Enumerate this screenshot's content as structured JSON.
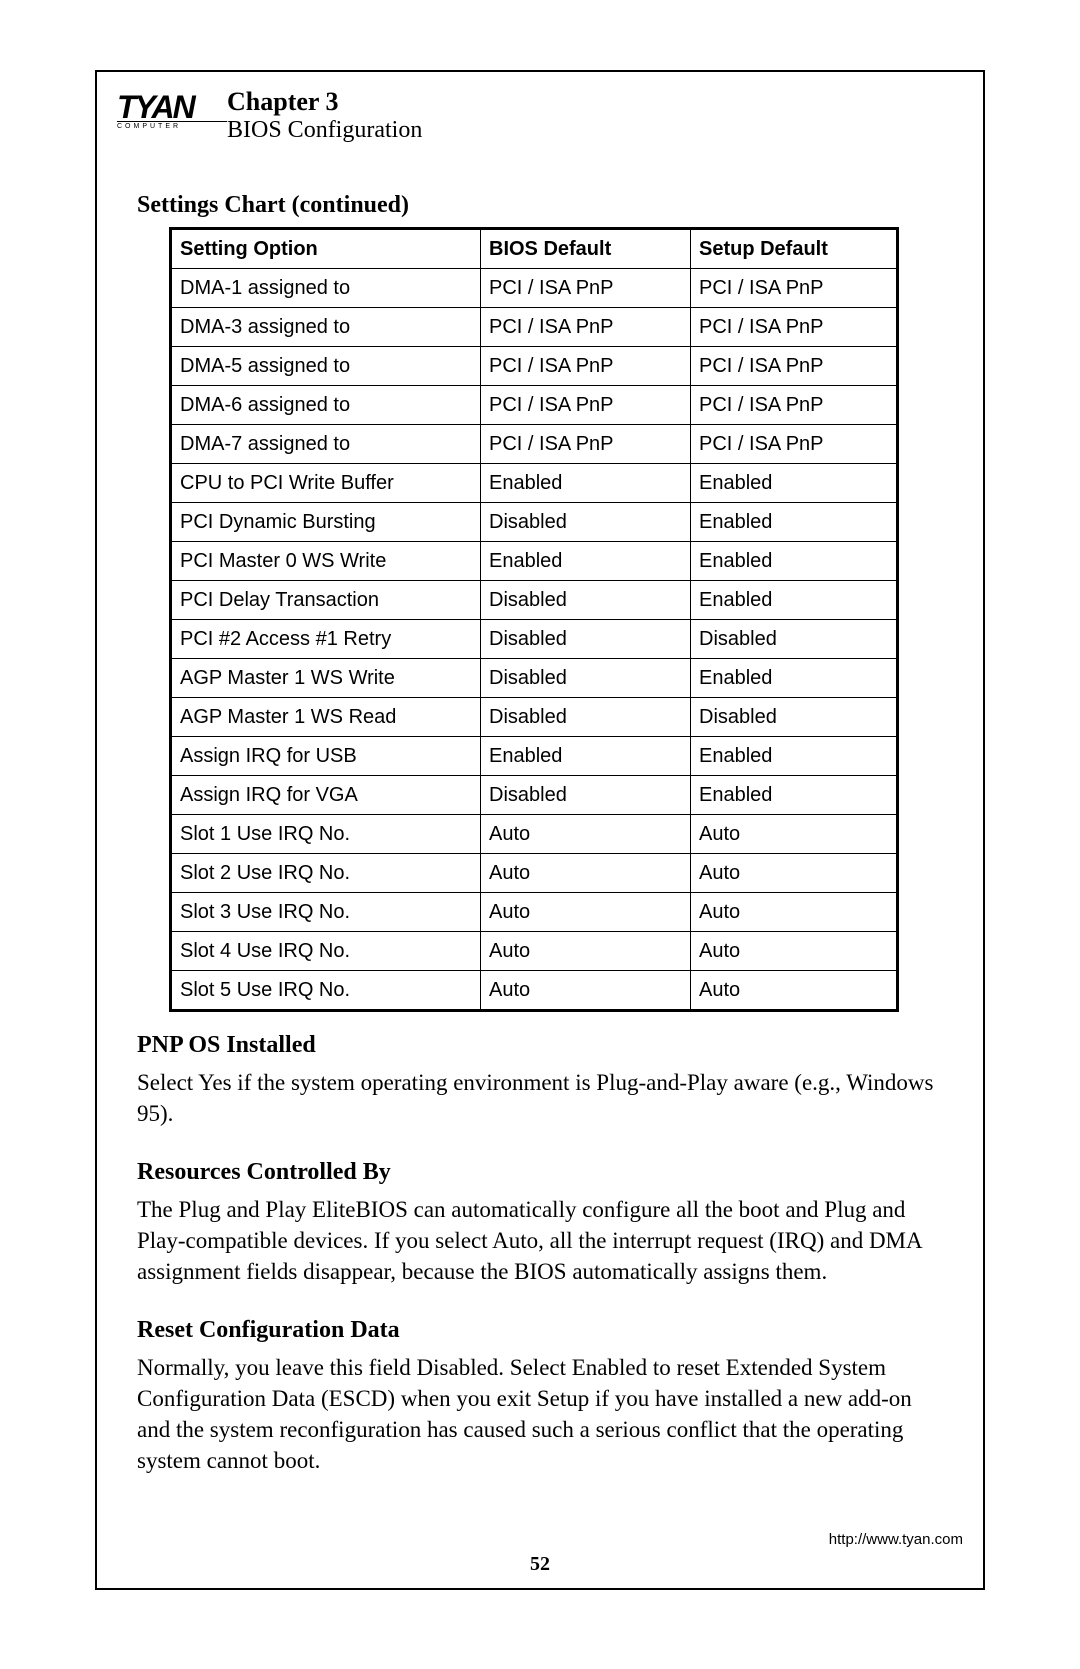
{
  "logo": {
    "brand": "TYAN",
    "sub": "COMPUTER"
  },
  "header": {
    "chapter": "Chapter 3",
    "subtitle": "BIOS Configuration"
  },
  "table": {
    "heading": "Settings Chart (continued)",
    "columns": [
      "Setting Option",
      "BIOS Default",
      "Setup Default"
    ],
    "rows": [
      [
        "DMA-1 assigned to",
        "PCI / ISA PnP",
        "PCI / ISA PnP"
      ],
      [
        "DMA-3 assigned to",
        "PCI / ISA PnP",
        "PCI / ISA PnP"
      ],
      [
        "DMA-5 assigned to",
        "PCI / ISA PnP",
        "PCI / ISA PnP"
      ],
      [
        "DMA-6 assigned to",
        "PCI / ISA PnP",
        "PCI / ISA PnP"
      ],
      [
        "DMA-7 assigned to",
        "PCI / ISA PnP",
        "PCI / ISA PnP"
      ],
      [
        "CPU to PCI Write Buffer",
        "Enabled",
        "Enabled"
      ],
      [
        "PCI Dynamic Bursting",
        "Disabled",
        "Enabled"
      ],
      [
        "PCI Master 0 WS Write",
        "Enabled",
        "Enabled"
      ],
      [
        "PCI Delay Transaction",
        "Disabled",
        "Enabled"
      ],
      [
        "PCI #2 Access #1 Retry",
        "Disabled",
        "Disabled"
      ],
      [
        "AGP Master 1 WS Write",
        "Disabled",
        "Enabled"
      ],
      [
        "AGP Master 1 WS Read",
        "Disabled",
        "Disabled"
      ],
      [
        "Assign IRQ for USB",
        "Enabled",
        "Enabled"
      ],
      [
        "Assign IRQ for VGA",
        "Disabled",
        "Enabled"
      ],
      [
        "Slot 1 Use IRQ No.",
        "Auto",
        "Auto"
      ],
      [
        "Slot 2 Use IRQ No.",
        "Auto",
        "Auto"
      ],
      [
        "Slot 3 Use IRQ No.",
        "Auto",
        "Auto"
      ],
      [
        "Slot 4 Use IRQ No.",
        "Auto",
        "Auto"
      ],
      [
        "Slot 5 Use IRQ No.",
        "Auto",
        "Auto"
      ]
    ]
  },
  "sections": [
    {
      "heading": "PNP OS Installed",
      "body": "Select Yes if the system operating environment is Plug-and-Play aware (e.g., Windows 95)."
    },
    {
      "heading": "Resources Controlled By",
      "body": "The Plug and Play EliteBIOS can automatically configure all the boot and Plug and Play-compatible devices. If you select Auto, all the interrupt request (IRQ) and DMA assignment fields disappear, because the BIOS automatically assigns them."
    },
    {
      "heading": "Reset Configuration Data",
      "body": "Normally, you leave this field Disabled. Select Enabled to reset Extended System Configuration Data (ESCD) when you exit Setup if you have installed a new add-on and the system reconfiguration has caused such a serious conflict that the operating system cannot boot."
    }
  ],
  "footer": {
    "url": "http://www.tyan.com",
    "page": "52"
  }
}
